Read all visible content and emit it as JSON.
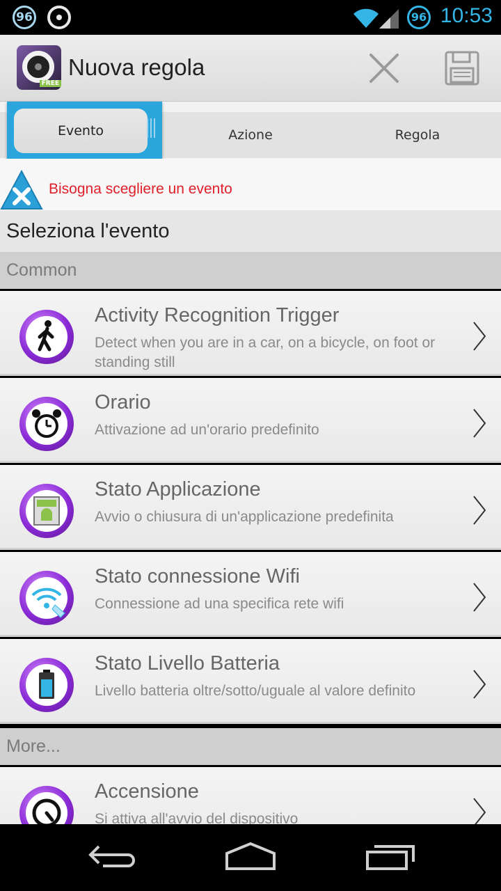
{
  "status_bar": {
    "badge_left": "96",
    "badge_right": "96",
    "time": "10:53"
  },
  "action_bar": {
    "title": "Nuova regola",
    "app_badge": "FREE"
  },
  "tabs": [
    {
      "label": "Evento",
      "active": true
    },
    {
      "label": "Azione",
      "active": false
    },
    {
      "label": "Regola",
      "active": false
    }
  ],
  "error": {
    "message": "Bisogna scegliere un evento"
  },
  "section_title": "Seleziona l'evento",
  "groups": {
    "common": "Common",
    "more": "More..."
  },
  "items": [
    {
      "icon": "walking-person-icon",
      "title": "Activity Recognition Trigger",
      "desc": "Detect when you are in a car, on a bicycle, on foot or standing still"
    },
    {
      "icon": "alarm-clock-icon",
      "title": "Orario",
      "desc": "Attivazione ad un'orario predefinito"
    },
    {
      "icon": "android-app-icon",
      "title": "Stato Applicazione",
      "desc": "Avvio o chiusura di un'applicazione predefinita"
    },
    {
      "icon": "wifi-icon",
      "title": "Stato connessione Wifi",
      "desc": "Connessione ad una specifica rete wifi"
    },
    {
      "icon": "battery-icon",
      "title": "Stato Livello Batteria",
      "desc": "Livello batteria oltre/sotto/uguale al valore definito"
    },
    {
      "icon": "power-icon",
      "title": "Accensione",
      "desc": "Si attiva all'avvio del dispositivo"
    }
  ],
  "colors": {
    "accent": "#33b5e5",
    "tab_active": "#2aa6dc",
    "error": "#e0202a",
    "icon_purple": "#8a2bd6"
  }
}
